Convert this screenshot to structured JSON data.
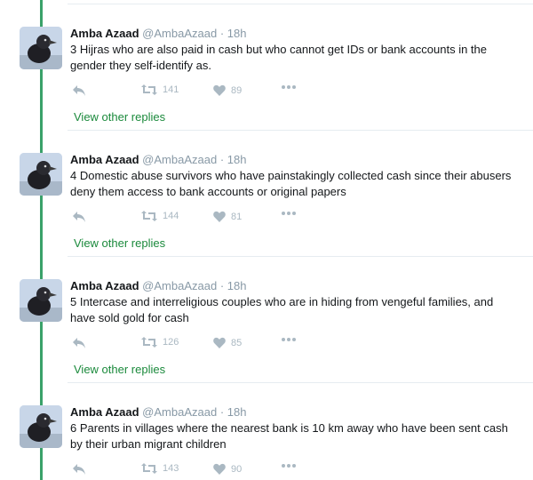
{
  "tweets": [
    {
      "name": "Amba Azaad",
      "handle": "@AmbaAzaad",
      "time": "18h",
      "text": "3 Hijras who are also paid in cash but who cannot get IDs or bank accounts in the gender they self-identify as.",
      "retweets": "141",
      "likes": "89",
      "view_replies": "View other replies"
    },
    {
      "name": "Amba Azaad",
      "handle": "@AmbaAzaad",
      "time": "18h",
      "text": "4 Domestic abuse survivors who have painstakingly collected cash since their abusers deny them access to bank accounts or original papers",
      "retweets": "144",
      "likes": "81",
      "view_replies": "View other replies"
    },
    {
      "name": "Amba Azaad",
      "handle": "@AmbaAzaad",
      "time": "18h",
      "text": "5 Intercase and interreligious couples who are in hiding from vengeful families, and have sold gold for cash",
      "retweets": "126",
      "likes": "85",
      "view_replies": "View other replies"
    },
    {
      "name": "Amba Azaad",
      "handle": "@AmbaAzaad",
      "time": "18h",
      "text": "6 Parents in villages where the nearest bank is 10 km away who have been sent cash by their urban migrant children",
      "retweets": "143",
      "likes": "90"
    }
  ],
  "colors": {
    "thread_line": "#3aa16a",
    "link": "#1b8a3c",
    "action_icon": "#aab8c2"
  }
}
